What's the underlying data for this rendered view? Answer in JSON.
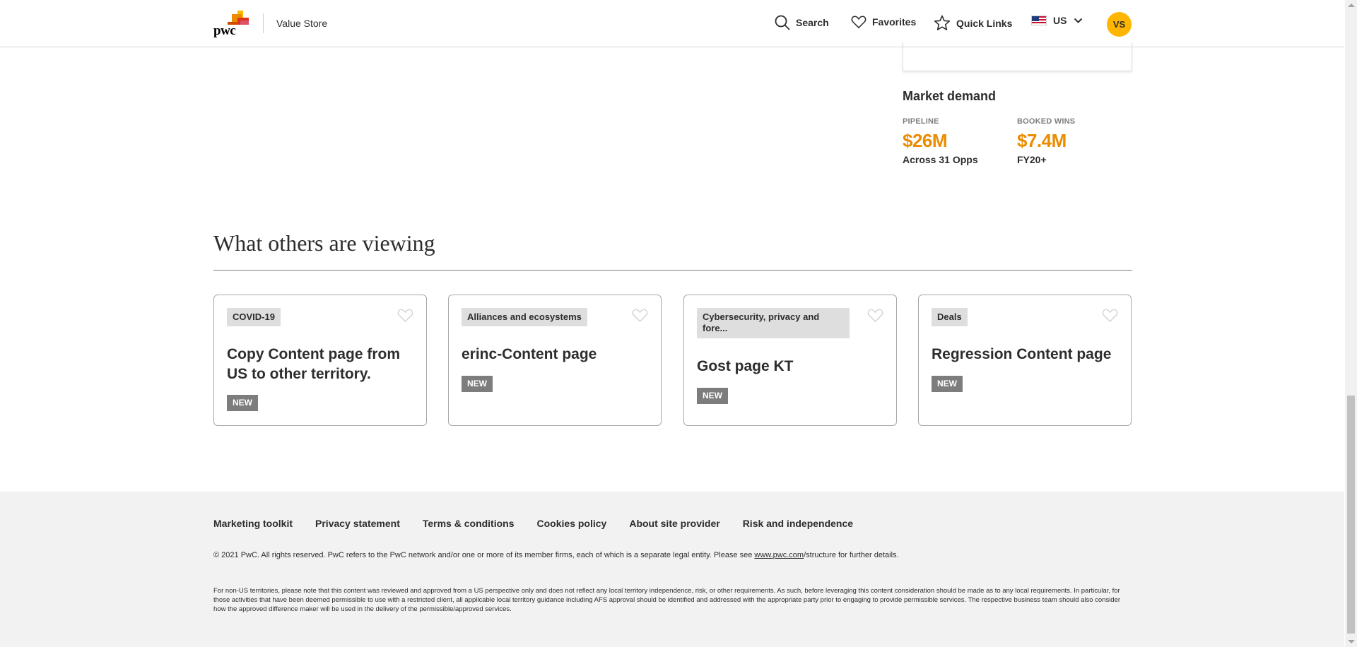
{
  "header": {
    "logo_text": "pwc",
    "site_title": "Value Store",
    "nav": {
      "search_label": "Search",
      "favorites_label": "Favorites",
      "quick_links_label": "Quick Links",
      "locale_label": "US"
    },
    "avatar_initials": "VS"
  },
  "market_demand": {
    "title": "Market demand",
    "pipeline": {
      "label": "PIPELINE",
      "value": "$26M",
      "sub": "Across 31 Opps"
    },
    "booked_wins": {
      "label": "BOOKED WINS",
      "value": "$7.4M",
      "sub": "FY20+"
    }
  },
  "others_viewing": {
    "title": "What others are viewing",
    "cards": [
      {
        "tag": "COVID-19",
        "title": "Copy Content page from US to other territory.",
        "badge": "NEW"
      },
      {
        "tag": "Alliances and ecosystems",
        "title": "erinc-Content page",
        "badge": "NEW"
      },
      {
        "tag": "Cybersecurity, privacy and fore...",
        "title": "Gost page KT",
        "badge": "NEW"
      },
      {
        "tag": "Deals",
        "title": "Regression Content page",
        "badge": "NEW"
      }
    ]
  },
  "footer": {
    "links": [
      "Marketing toolkit",
      "Privacy statement",
      "Terms & conditions",
      "Cookies policy",
      "About site provider",
      "Risk and independence"
    ],
    "copyright_before": "© 2021 PwC. All rights reserved. PwC refers to the PwC network and/or one or more of its member firms, each of which is a separate legal entity. Please see ",
    "copyright_link": "www.pwc.com",
    "copyright_after": "/structure for further details.",
    "disclaimer": "For non-US territories, please note that this content was reviewed and approved from a US perspective only and does not reflect any local territory independence, risk, or other requirements. As such, before leveraging this content consideration should be made as to any local requirements. In particular, for those activities that have been deemed permissible to use with a restricted client, all applicable local territory guidance including AFS approval should be identified and addressed with the appropriate party prior to engaging to provide permissible services. The respective business team should also consider how the approved difference maker will be used in the delivery of the permissible/approved services."
  },
  "colors": {
    "accent_orange": "#eb8c00",
    "avatar_yellow": "#ffb600",
    "badge_gray": "#7d7d7d",
    "tag_gray": "#dedede",
    "footer_bg": "#f2f2f2"
  },
  "icons": [
    "pwc-logo-icon",
    "search-icon",
    "heart-icon",
    "star-icon",
    "us-flag-icon",
    "chevron-down-icon"
  ]
}
